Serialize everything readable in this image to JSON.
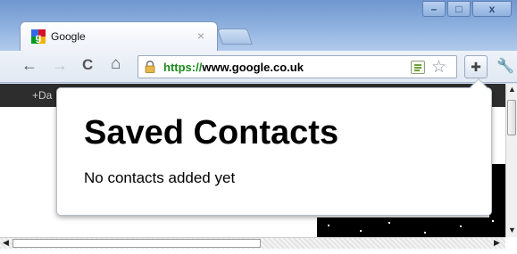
{
  "window": {
    "controls": {
      "minimize": "–",
      "maximize": "□",
      "close": "x"
    }
  },
  "tab": {
    "title": "Google",
    "close_glyph": "×",
    "favicon": "google-favicon-icon"
  },
  "toolbar": {
    "back_glyph": "←",
    "forward_glyph": "→",
    "reload_glyph": "C",
    "home_glyph": "⌂",
    "url_scheme": "https://",
    "url_host": "www.google.co.uk",
    "star_glyph": "☆",
    "extension_glyph": "✚",
    "wrench_glyph": "🔧"
  },
  "page": {
    "gbar_text": "+Da"
  },
  "popup": {
    "title": "Saved Contacts",
    "message": "No contacts added yet"
  },
  "colors": {
    "secure_scheme": "#1b8a1b",
    "frame_blue": "#6f97cf"
  }
}
